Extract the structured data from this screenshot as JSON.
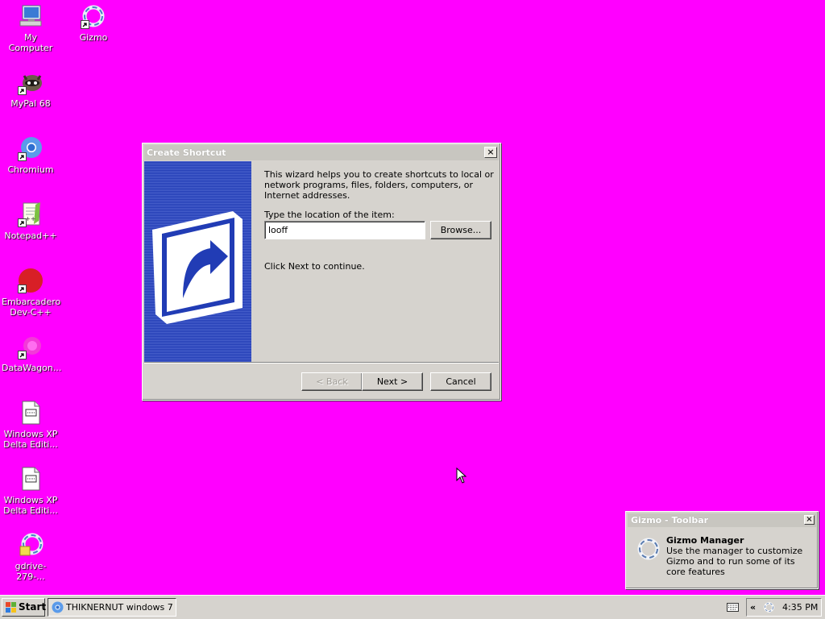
{
  "desktop": {
    "background_color": "#ff00ff",
    "icons": [
      {
        "label": "My Computer",
        "icon": "computer-icon"
      },
      {
        "label": "Gizmo",
        "icon": "gizmo-icon"
      },
      {
        "label": "MyPal 68",
        "icon": "mypal-raccoon-icon"
      },
      {
        "label": "Chromium",
        "icon": "chromium-icon"
      },
      {
        "label": "Notepad++",
        "icon": "notepadpp-icon"
      },
      {
        "label": "Embarcadero Dev-C++",
        "icon": "devcpp-icon"
      },
      {
        "label": "DataWagon...",
        "icon": "datawagon-icon"
      },
      {
        "label": "Windows XP Delta Editi...",
        "icon": "text-file-icon"
      },
      {
        "label": "Windows XP Delta Editi...",
        "icon": "text-file-icon"
      },
      {
        "label": "gdrive-279-...",
        "icon": "gdrive-icon"
      }
    ]
  },
  "dialog": {
    "title": "Create Shortcut",
    "description": "This wizard helps you to create shortcuts to local or network programs, files, folders, computers, or Internet addresses.",
    "location_label": "Type the location of the item:",
    "location_value": "looff",
    "browse_label": "Browse...",
    "continue_text": "Click Next to continue.",
    "back_label": "< Back",
    "next_label": "Next >",
    "cancel_label": "Cancel",
    "close_label": "×"
  },
  "popup": {
    "title": "Gizmo - Toolbar",
    "heading": "Gizmo Manager",
    "text": "Use the manager to customize Gizmo and to run some of its core features",
    "close_label": "×"
  },
  "taskbar": {
    "start_label": "Start",
    "task_label": "THIKNERNUT windows 7 ...",
    "tray_chevron": "«",
    "clock": "4:35 PM"
  }
}
